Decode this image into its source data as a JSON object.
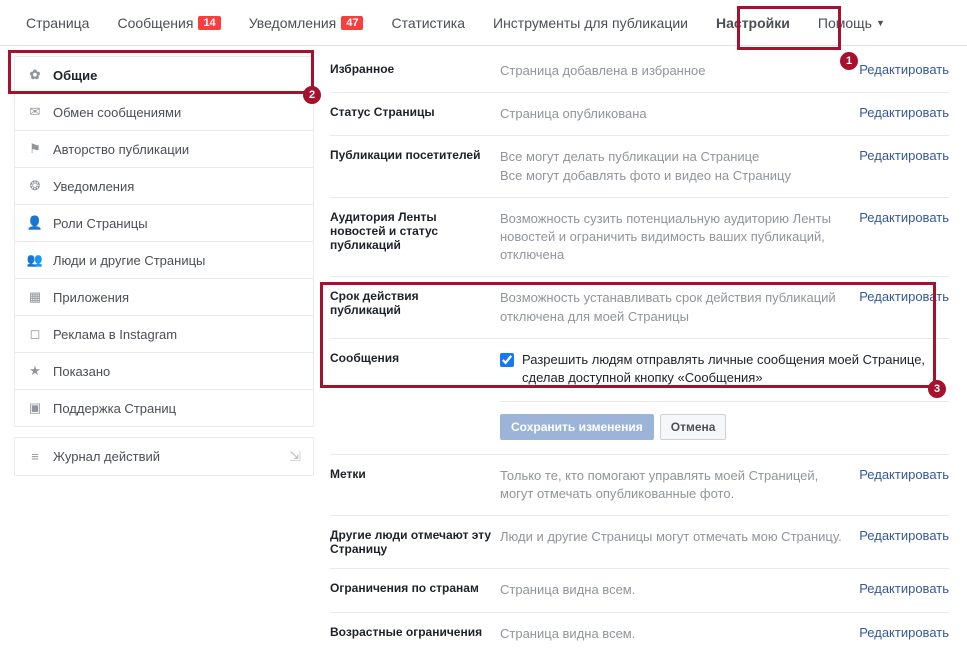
{
  "annotations": {
    "n1": "1",
    "n2": "2",
    "n3": "3"
  },
  "topnav": {
    "page": "Страница",
    "inbox": "Сообщения",
    "inbox_badge": "14",
    "notifications": "Уведомления",
    "notifications_badge": "47",
    "insights": "Статистика",
    "publishing": "Инструменты для публикации",
    "settings": "Настройки",
    "help": "Помощь"
  },
  "sidebar": {
    "general": "Общие",
    "messaging": "Обмен сообщениями",
    "attribution": "Авторство публикации",
    "notifications": "Уведомления",
    "roles": "Роли Страницы",
    "people": "Люди и другие Страницы",
    "apps": "Приложения",
    "instagram": "Реклама в Instagram",
    "featured": "Показано",
    "support": "Поддержка Страниц",
    "activity": "Журнал действий"
  },
  "rows": {
    "favorites": {
      "label": "Избранное",
      "desc": "Страница добавлена в избранное"
    },
    "status": {
      "label": "Статус Страницы",
      "desc": "Страница опубликована"
    },
    "visitors": {
      "label": "Публикации посетителей",
      "desc1": "Все могут делать публикации на Странице",
      "desc2": "Все могут добавлять фото и видео на Страницу"
    },
    "audience": {
      "label": "Аудитория Ленты новостей и статус публикаций",
      "desc": "Возможность сузить потенциальную аудиторию Ленты новостей и ограничить видимость ваших публикаций, отключена"
    },
    "expiration": {
      "label": "Срок действия публикаций",
      "desc": "Возможность устанавливать срок действия публикаций отключена для моей Страницы"
    },
    "messages": {
      "label": "Сообщения",
      "desc": "Разрешить людям отправлять личные сообщения моей Странице, сделав доступной кнопку «Сообщения»",
      "save": "Сохранить изменения",
      "cancel": "Отмена"
    },
    "tags": {
      "label": "Метки",
      "desc": "Только те, кто помогают управлять моей Страницей, могут отмечать опубликованные фото."
    },
    "others_tag": {
      "label": "Другие люди отмечают эту Страницу",
      "desc": "Люди и другие Страницы могут отмечать мою Страницу."
    },
    "country": {
      "label": "Ограничения по странам",
      "desc": "Страница видна всем."
    },
    "age": {
      "label": "Возрастные ограничения",
      "desc": "Страница видна всем."
    }
  },
  "edit": "Редактировать"
}
